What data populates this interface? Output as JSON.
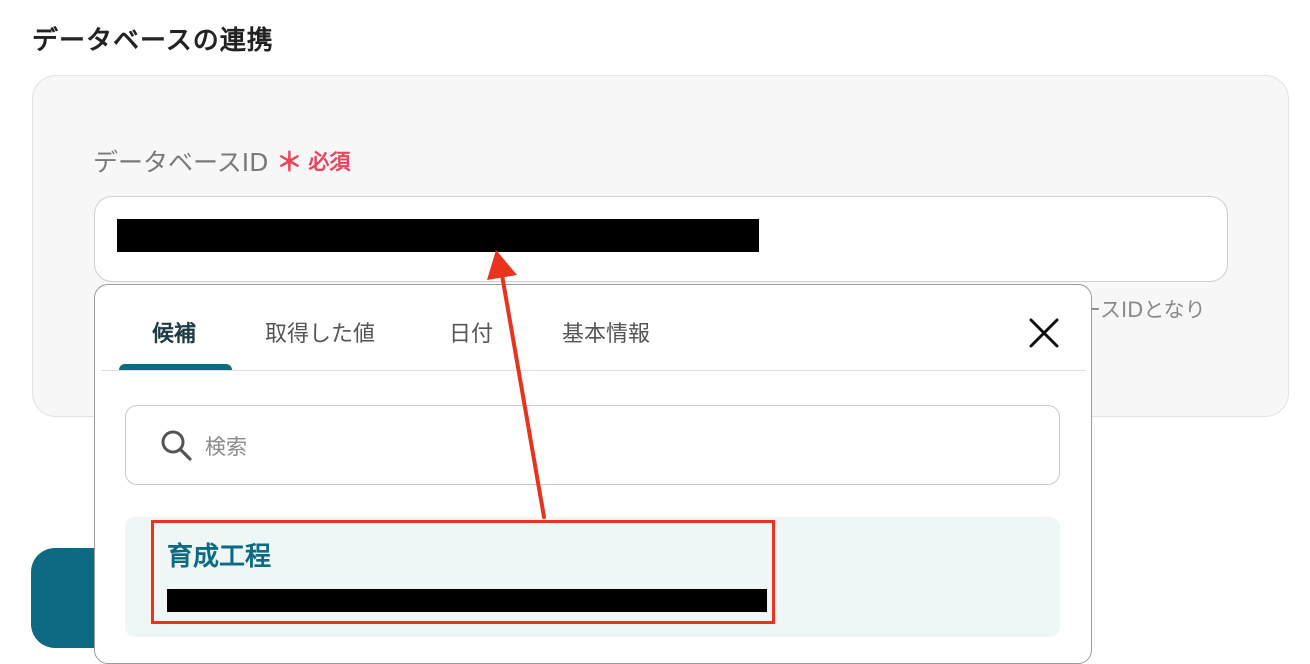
{
  "section": {
    "title": "データベースの連携"
  },
  "field": {
    "label": "データベースID",
    "required_mark": "＊",
    "required_text": "必須",
    "helper_text": "ースIDとなり"
  },
  "dropdown": {
    "tabs": [
      {
        "label": "候補",
        "active": true
      },
      {
        "label": "取得した値",
        "active": false
      },
      {
        "label": "日付",
        "active": false
      },
      {
        "label": "基本情報",
        "active": false
      }
    ],
    "search_placeholder": "検索",
    "candidates": [
      {
        "title": "育成工程"
      }
    ]
  },
  "colors": {
    "accent": "#0e6a82",
    "required": "#e8445a",
    "annotation": "#e8341c",
    "candidate_bg": "#eef7f6"
  },
  "icons": {
    "close": "close-icon",
    "search": "search-icon"
  }
}
